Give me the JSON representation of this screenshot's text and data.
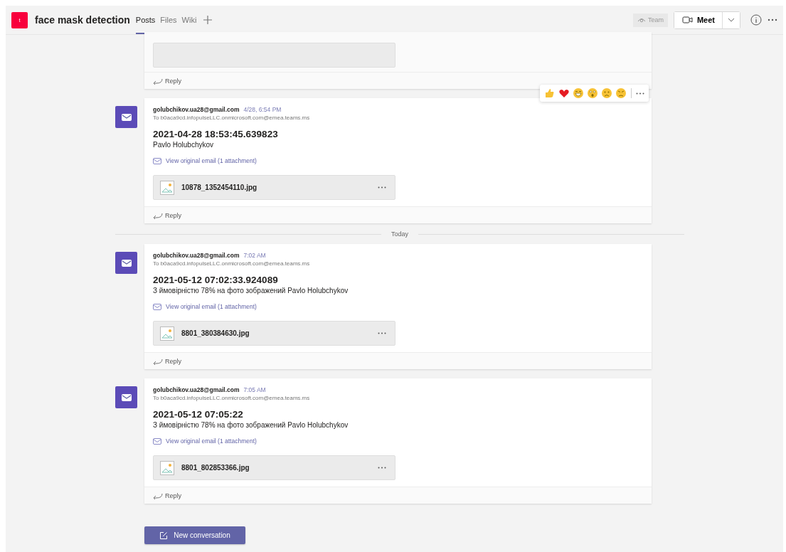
{
  "header": {
    "team_initial": "t",
    "title": "face mask detection",
    "tabs": [
      {
        "label": "Posts",
        "selected": true
      },
      {
        "label": "Files",
        "selected": false
      },
      {
        "label": "Wiki",
        "selected": false
      }
    ],
    "team_button": "Team",
    "meet_button": "Meet"
  },
  "feed": [
    {
      "kind": "cut_post",
      "reply": "Reply"
    },
    {
      "kind": "post",
      "sender": "golubchikov.ua28@gmail.com",
      "time": "4/28, 6:54 PM",
      "to": "To b0aca9cd.infopulseLLC.onmicrosoft.com@emea.teams.ms",
      "subject": "2021-04-28 18:53:45.639823",
      "body": "Pavlo Holubchykov",
      "link": "View original email (1 attachment)",
      "attachment": "10878_1352454110.jpg",
      "reply": "Reply",
      "reactions_shown": true
    },
    {
      "kind": "divider",
      "label": "Today"
    },
    {
      "kind": "post",
      "sender": "golubchikov.ua28@gmail.com",
      "time": "7:02 AM",
      "to": "To b0aca9cd.infopulseLLC.onmicrosoft.com@emea.teams.ms",
      "subject": "2021-05-12 07:02:33.924089",
      "body": "З ймовірністю 78% на фото зображений Pavlo Holubchykov",
      "link": "View original email (1 attachment)",
      "attachment": "8801_380384630.jpg",
      "reply": "Reply",
      "reactions_shown": false
    },
    {
      "kind": "post",
      "sender": "golubchikov.ua28@gmail.com",
      "time": "7:05 AM",
      "to": "To b0aca9cd.infopulseLLC.onmicrosoft.com@emea.teams.ms",
      "subject": "2021-05-12 07:05:22",
      "body": "З ймовірністю 78% на фото зображений Pavlo Holubchykov",
      "link": "View original email (1 attachment)",
      "attachment": "8801_802853366.jpg",
      "reply": "Reply",
      "reactions_shown": false
    }
  ],
  "new_conversation": "New conversation"
}
